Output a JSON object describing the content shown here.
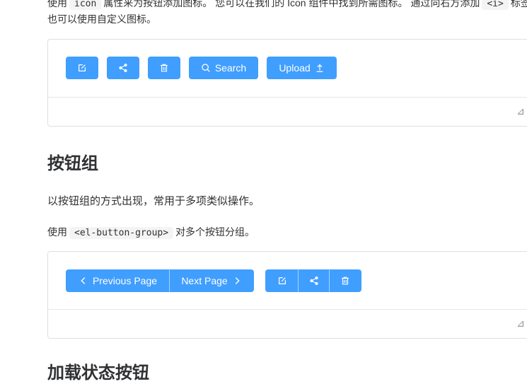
{
  "intro": {
    "line1_pre": "使用",
    "line1_code": "icon",
    "line1_mid": "属性来为按钮添加图标。 您可以在我们的 Icon 组件中找到所需图标。 通过向右方添加",
    "line1_code2": "<i>",
    "line1_end": "标签",
    "line2": "也可以使用自定义图标。"
  },
  "demo1": {
    "search_label": "Search",
    "upload_label": "Upload"
  },
  "section_group": {
    "title": "按钮组",
    "desc": "以按钮组的方式出现，常用于多项类似操作。",
    "usage_pre": "使用",
    "usage_code": "<el-button-group>",
    "usage_post": "对多个按钮分组。"
  },
  "demo2": {
    "prev_label": "Previous Page",
    "next_label": "Next Page"
  },
  "section_loading": {
    "title": "加载状态按钮"
  },
  "colors": {
    "primary": "#409eff",
    "border": "#dcdfe6"
  },
  "icons": [
    "edit-icon",
    "share-icon",
    "delete-icon",
    "search-icon",
    "upload-icon",
    "arrow-left-icon",
    "arrow-right-icon",
    "code-toggle-icon"
  ]
}
